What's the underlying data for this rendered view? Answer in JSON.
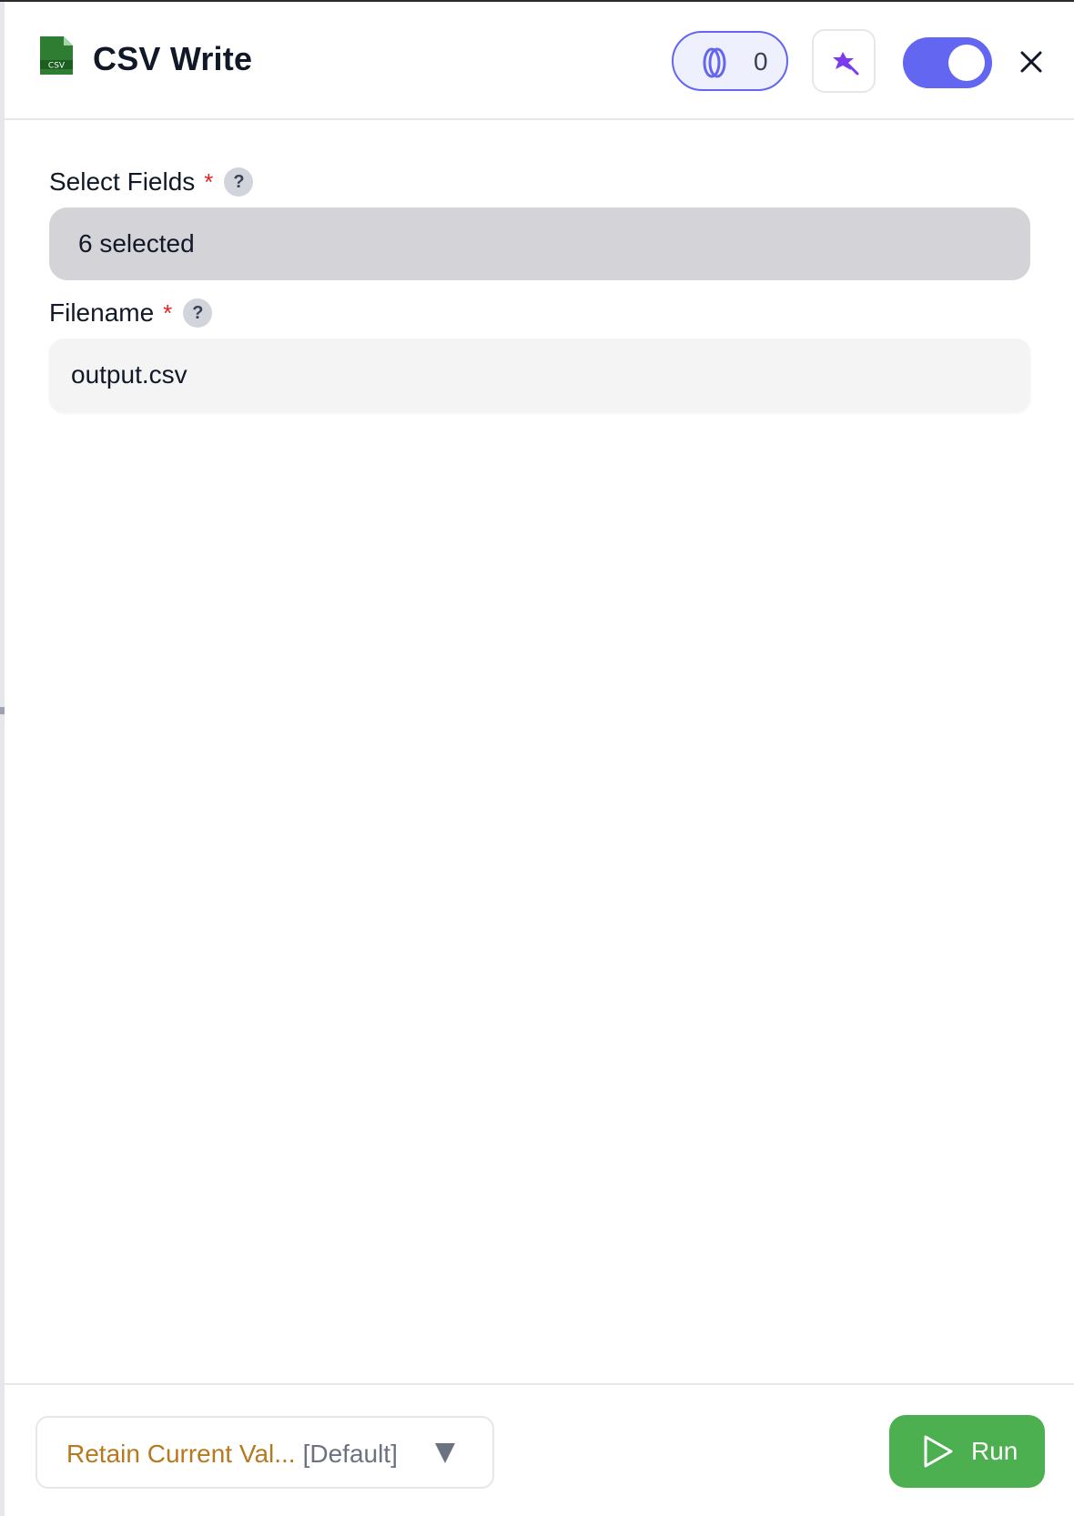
{
  "header": {
    "title": "CSV Write",
    "file_icon_text": "CSV",
    "counter_value": "0"
  },
  "form": {
    "select_fields": {
      "label": "Select Fields",
      "required_mark": "*",
      "help": "?",
      "value": "6 selected"
    },
    "filename": {
      "label": "Filename",
      "required_mark": "*",
      "help": "?",
      "value": "output.csv"
    }
  },
  "footer": {
    "retain_label": "Retain Current Val...",
    "retain_default": "[Default]",
    "run_label": "Run"
  },
  "icons": [
    "csv-file-icon",
    "ring-icon",
    "magic-wand-icon",
    "close-icon",
    "play-icon",
    "chevron-down-icon"
  ],
  "colors": {
    "accent": "#6366f1",
    "run_green": "#4caf50",
    "retain_text": "#b7791f",
    "required": "#dc2626"
  },
  "toggle_on": true
}
